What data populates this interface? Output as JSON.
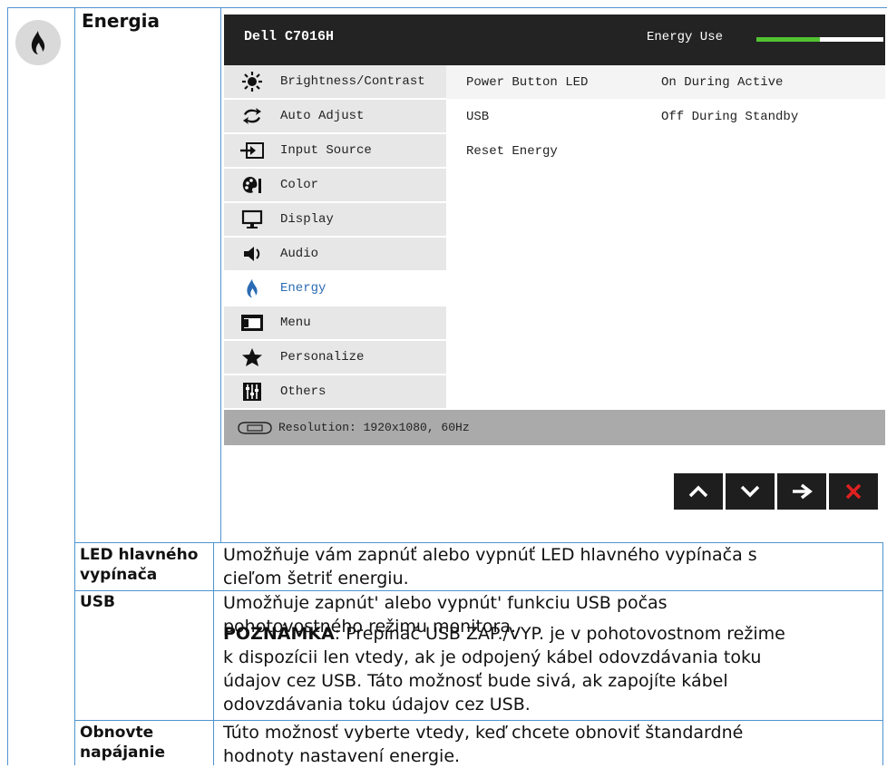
{
  "section": {
    "title": "Energia",
    "icon": "flame-icon"
  },
  "osd": {
    "model": "Dell C7016H",
    "energy_use_label": "Energy Use",
    "energy_level": 0.5,
    "menu": [
      {
        "label": "Brightness/Contrast",
        "icon": "sun-icon"
      },
      {
        "label": "Auto Adjust",
        "icon": "auto-adjust-icon"
      },
      {
        "label": "Input Source",
        "icon": "input-source-icon"
      },
      {
        "label": "Color",
        "icon": "color-palette-icon"
      },
      {
        "label": "Display",
        "icon": "monitor-icon"
      },
      {
        "label": "Audio",
        "icon": "speaker-icon"
      },
      {
        "label": "Energy",
        "icon": "flame-icon",
        "active": true
      },
      {
        "label": "Menu",
        "icon": "menu-window-icon"
      },
      {
        "label": "Personalize",
        "icon": "star-icon"
      },
      {
        "label": "Others",
        "icon": "sliders-icon"
      }
    ],
    "settings": [
      {
        "name": "Power Button LED",
        "value": "On During Active"
      },
      {
        "name": "USB",
        "value": "Off During Standby"
      },
      {
        "name": "Reset Energy",
        "value": ""
      }
    ],
    "resolution": "Resolution: 1920x1080, 60Hz",
    "nav_buttons": [
      "up-arrow-icon",
      "down-arrow-icon",
      "right-arrow-icon",
      "close-x-icon"
    ]
  },
  "rows": [
    {
      "label_line1": "LED hlavného",
      "label_line2": "vypínača",
      "desc_line1": "Umožňuje vám zapnúť alebo vypnúť LED hlavného vypínača s",
      "desc_line2": "cieľom šetriť energiu."
    },
    {
      "label": "USB",
      "desc_line1": "Umožňuje zapnút' alebo vypnút' funkciu USB počas",
      "desc_line2": "pohotovostného režimu monitora.",
      "note_bold": "POZNÁMKA",
      "note_line1": ": Prepínač USB ZAP./VYP. je v pohotovostnom režime",
      "note_line2": "k dispozícii len vtedy, ak je odpojený kábel odovzdávania toku",
      "note_line3": "údajov cez USB. Táto možnosť bude sivá, ak zapojíte kábel",
      "note_line4": "odovzdávania toku údajov cez USB."
    },
    {
      "label_line1": "Obnovte",
      "label_line2": "napájanie",
      "desc_line1": "Túto možnosť vyberte vtedy, keď chcete obnoviť štandardné",
      "desc_line2": "hodnoty nastavení energie."
    }
  ],
  "colors": {
    "grid": "#4f95cf",
    "osd_header": "#232323",
    "energy_bar": "#52c233",
    "active": "#2b6bb3",
    "close": "#e02020"
  }
}
